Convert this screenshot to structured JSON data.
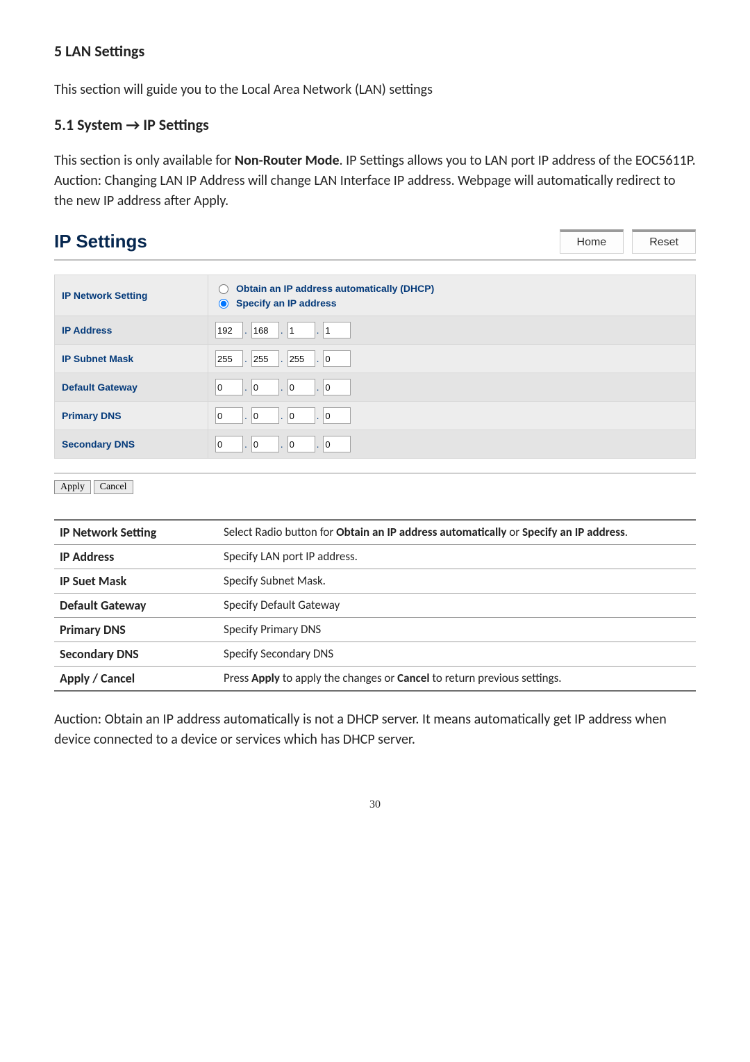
{
  "headings": {
    "section": "5 LAN Settings",
    "subsection": "5.1 System → IP Settings"
  },
  "paragraphs": {
    "intro": "This section will guide you to the Local Area Network (LAN) settings",
    "p1a": "This section is only available for ",
    "p1b": "Non-Router Mode",
    "p1c": ". IP Settings allows you to LAN port IP address of the EOC5611P.",
    "p2": "Auction: Changing LAN IP Address will change LAN Interface IP address. Webpage will automatically redirect to the new IP address after Apply.",
    "note": "Auction: Obtain an IP address automatically is not a DHCP server. It means automatically get IP address when device connected to a device or services which has DHCP server."
  },
  "titlebar": {
    "title": "IP Settings",
    "home": "Home",
    "reset": "Reset"
  },
  "form": {
    "labels": {
      "network_setting": "IP Network Setting",
      "ip_address": "IP Address",
      "subnet": "IP Subnet Mask",
      "gateway": "Default Gateway",
      "primary_dns": "Primary DNS",
      "secondary_dns": "Secondary DNS"
    },
    "radios": {
      "dhcp": "Obtain an IP address automatically (DHCP)",
      "specify": "Specify an IP address",
      "selected": "specify"
    },
    "values": {
      "ip": [
        "192",
        "168",
        "1",
        "1"
      ],
      "subnet": [
        "255",
        "255",
        "255",
        "0"
      ],
      "gateway": [
        "0",
        "0",
        "0",
        "0"
      ],
      "pdns": [
        "0",
        "0",
        "0",
        "0"
      ],
      "sdns": [
        "0",
        "0",
        "0",
        "0"
      ]
    }
  },
  "buttons": {
    "apply": "Apply",
    "cancel": "Cancel"
  },
  "desc_table": [
    {
      "label": "IP Network Setting",
      "desc_pre": "Select Radio button for ",
      "desc_b1": "Obtain an IP address automatically",
      "desc_mid": " or ",
      "desc_b2": "Specify an IP address",
      "desc_post": "."
    },
    {
      "label": "IP Address",
      "desc": "Specify LAN port IP address."
    },
    {
      "label": "IP Suet Mask",
      "desc": "Specify Subnet Mask."
    },
    {
      "label": "Default Gateway",
      "desc": "Specify Default Gateway"
    },
    {
      "label": "Primary DNS",
      "desc": "Specify Primary DNS"
    },
    {
      "label": "Secondary DNS",
      "desc": "Specify Secondary DNS"
    },
    {
      "label": "Apply / Cancel",
      "desc_pre": "Press ",
      "desc_b1": "Apply",
      "desc_mid": " to apply the changes or ",
      "desc_b2": "Cancel",
      "desc_post": " to return previous settings."
    }
  ],
  "page_number": "30"
}
